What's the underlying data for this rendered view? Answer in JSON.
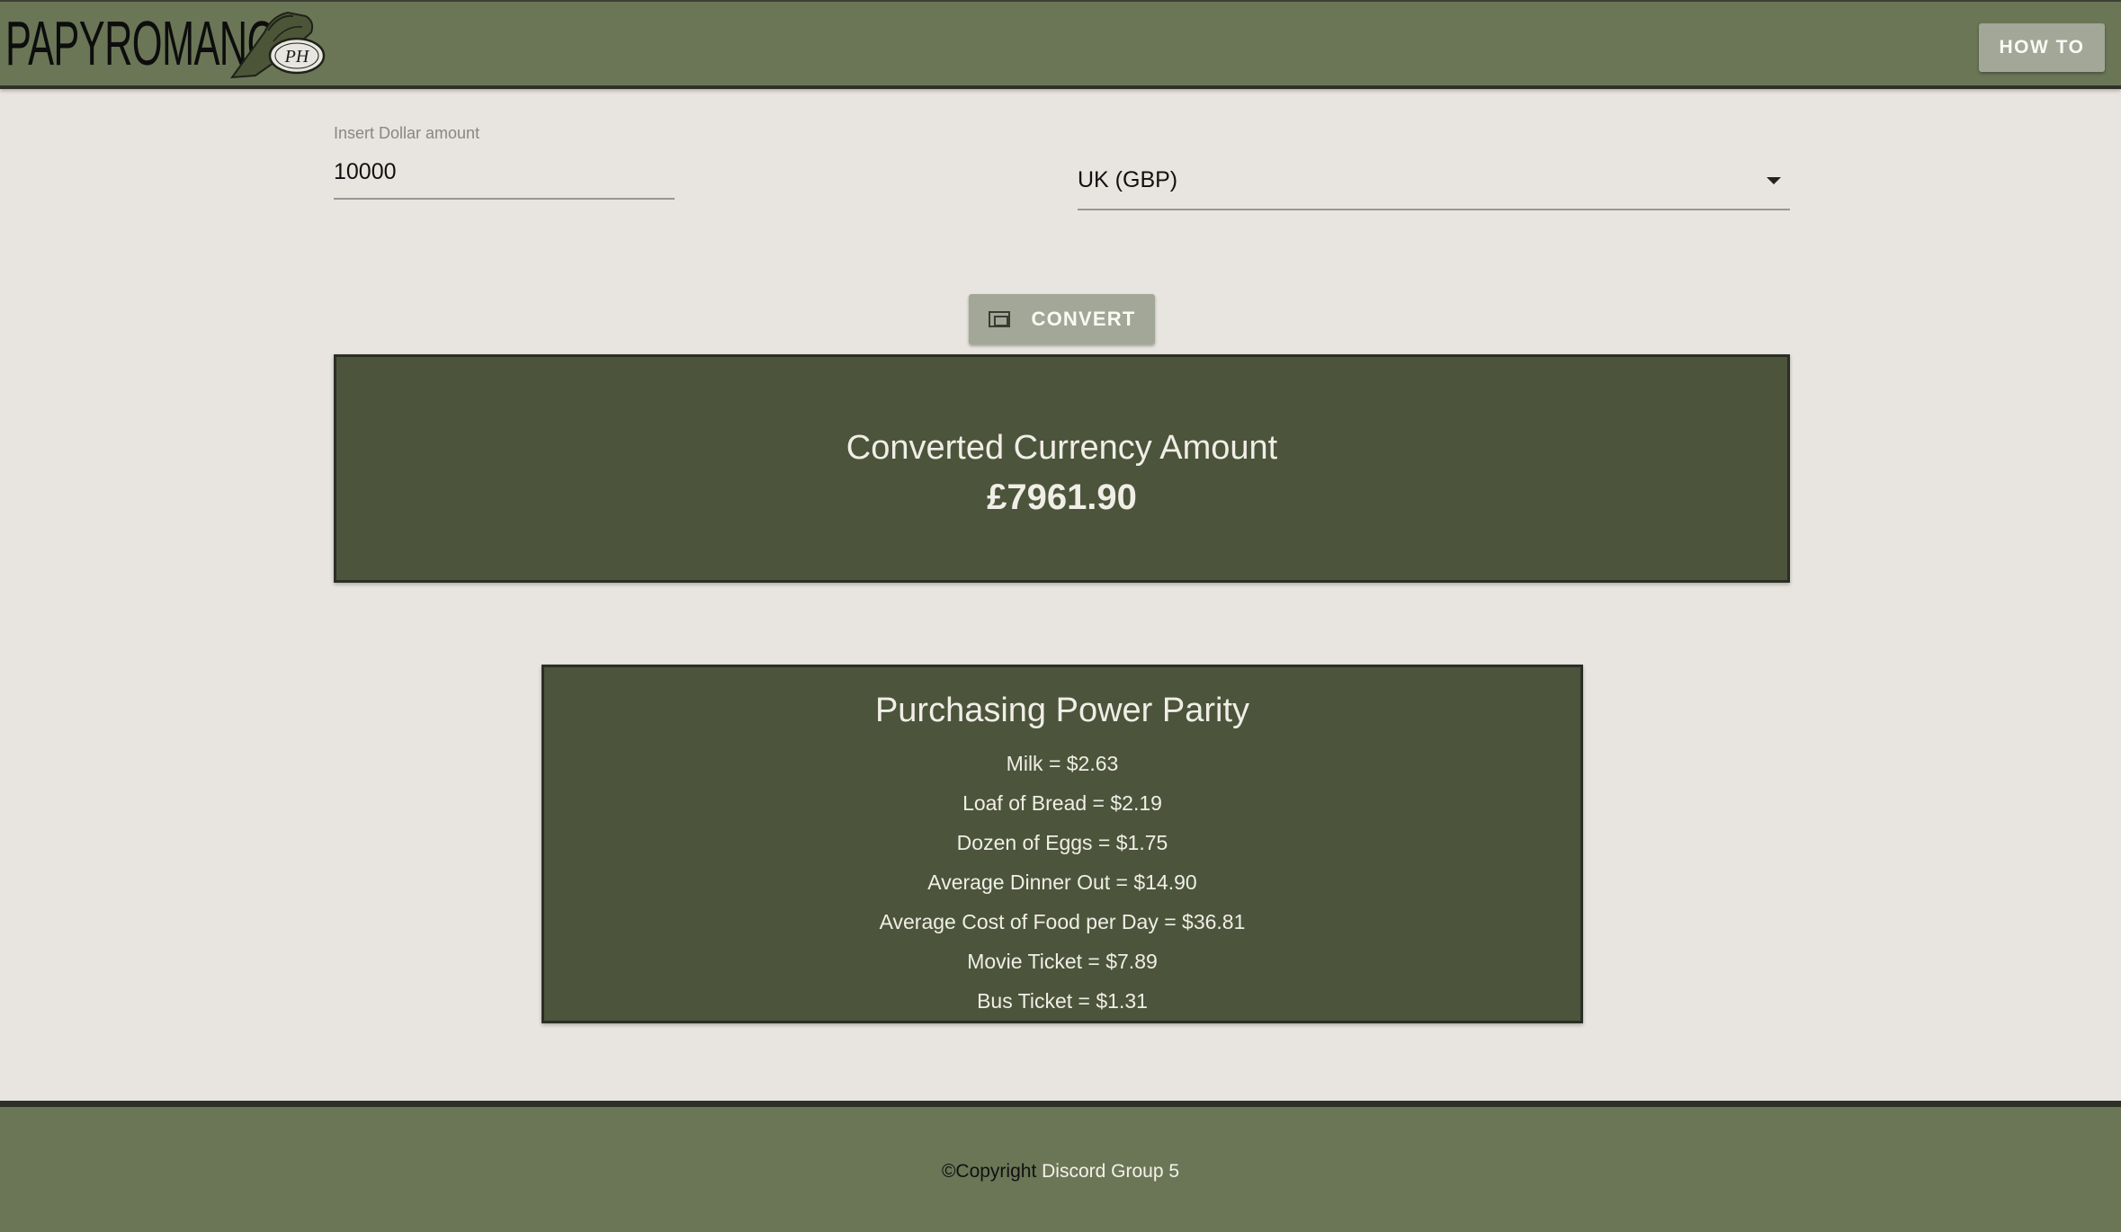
{
  "header": {
    "logo_text": "PAPYROMANCY",
    "logo_emblem_text": "PH",
    "howto_label": "HOW TO"
  },
  "form": {
    "amount_label": "Insert Dollar amount",
    "amount_value": "10000",
    "currency_selected": "UK (GBP)",
    "convert_label": "CONVERT"
  },
  "result": {
    "title": "Converted Currency Amount",
    "amount": "£7961.90"
  },
  "ppp": {
    "title": "Purchasing Power Parity",
    "items": [
      "Milk = $2.63",
      "Loaf of Bread = $2.19",
      "Dozen of Eggs = $1.75",
      "Average Dinner Out = $14.90",
      "Average Cost of Food per Day = $36.81",
      "Movie Ticket = $7.89",
      "Bus Ticket = $1.31"
    ]
  },
  "footer": {
    "copyright_mark": "©Copyright",
    "owner": "Discord Group 5"
  },
  "colors": {
    "header_bg": "#6b7657",
    "panel_bg": "#4c543b",
    "page_bg": "#e8e4df",
    "button_bg": "#a3a797"
  }
}
